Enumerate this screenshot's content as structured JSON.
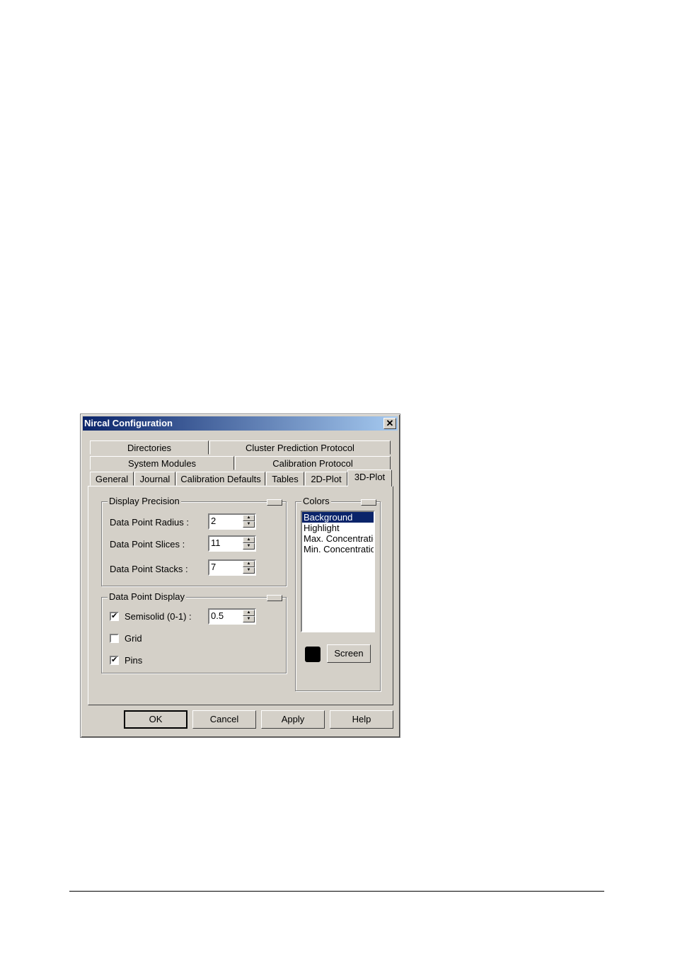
{
  "dialog": {
    "title": "Nircal Configuration",
    "close_glyph": "✕"
  },
  "tabs": {
    "row1": [
      "Directories",
      "Cluster Prediction Protocol"
    ],
    "row2": [
      "System Modules",
      "Calibration Protocol"
    ],
    "row3": [
      "General",
      "Journal",
      "Calibration Defaults",
      "Tables",
      "2D-Plot",
      "3D-Plot"
    ],
    "active": "3D-Plot"
  },
  "display_precision": {
    "title": "Display Precision",
    "radius_label": "Data Point Radius :",
    "radius_value": "2",
    "slices_label": "Data Point Slices :",
    "slices_value": "11",
    "stacks_label": "Data Point Stacks :",
    "stacks_value": "7"
  },
  "data_point_display": {
    "title": "Data Point Display",
    "semisolid_label": "Semisolid (0-1) :",
    "semisolid_checked": "✔",
    "semisolid_value": "0.5",
    "grid_label": "Grid",
    "grid_checked": "",
    "pins_label": "Pins",
    "pins_checked": "✔"
  },
  "colors": {
    "title": "Colors",
    "items": [
      "Background",
      "Highlight",
      "Max. Concentration",
      "Min. Concentration"
    ],
    "selected": "Background",
    "swatch_color": "#000000",
    "screen_button": "Screen"
  },
  "buttons": {
    "ok": "OK",
    "cancel": "Cancel",
    "apply": "Apply",
    "help": "Help"
  },
  "spin_glyphs": {
    "up": "▲",
    "down": "▼"
  }
}
